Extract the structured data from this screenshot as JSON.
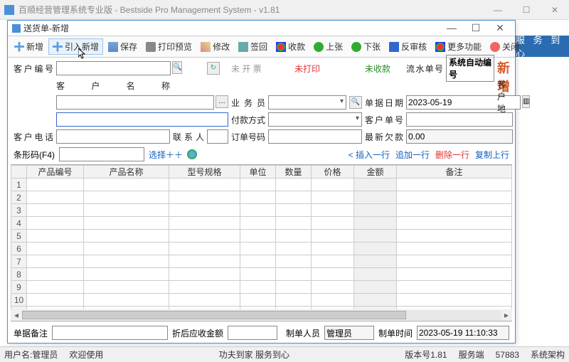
{
  "outer": {
    "title": "百顺经营管理系统专业版 - Bestside Pro Management System - v1.81",
    "min": "—",
    "max": "☐",
    "close": "✕"
  },
  "banner": "服 务 到 心",
  "inner": {
    "title": "送货单-新增",
    "min": "—",
    "max": "☐",
    "close": "✕"
  },
  "toolbar": {
    "new": "新增",
    "import": "引入新增",
    "save": "保存",
    "print": "打印预览",
    "edit": "修改",
    "sign": "签回",
    "pay": "收款",
    "prev": "上张",
    "next": "下张",
    "review": "反审核",
    "more": "更多功能",
    "close": "关闭"
  },
  "status_flags": {
    "unbilled": "未 开 票",
    "unprinted": "未打印",
    "unpaid": "未收款"
  },
  "labels": {
    "cust_no": "客户编号",
    "cust_name": "客户名称",
    "cust_addr": "客户地址",
    "cust_tel": "客户电话",
    "contact": "联系人",
    "salesman": "业务员",
    "pay_method": "付款方式",
    "order_no": "订单号码",
    "flow_no": "流水单号",
    "doc_date": "单据日期",
    "cust_doc": "客户单号",
    "latest_owe": "最新欠款",
    "barcode": "条形码(F4)",
    "select": "选择＋＋",
    "remark": "单据备注",
    "after_disc": "折后应收金额",
    "maker": "制单人员",
    "maketime": "制单时间"
  },
  "values": {
    "cust_no": "",
    "cust_name": "",
    "cust_addr": "",
    "cust_tel": "",
    "contact": "",
    "salesman": "",
    "pay_method": "",
    "order_no": "",
    "flow_no": "系统自动编号",
    "doc_date": "2023-05-19",
    "cust_doc": "",
    "latest_owe": "0.00",
    "barcode": "",
    "remark": "",
    "after_disc": "",
    "maker": "管理员",
    "maketime": "2023-05-19 11:10:33"
  },
  "big_new": "新增",
  "row_actions": {
    "insert": "< 插入一行",
    "append": "追加一行",
    "delete": "删除一行",
    "copy": "复制上行"
  },
  "grid": {
    "headers": [
      "产品编号",
      "产品名称",
      "型号规格",
      "单位",
      "数量",
      "价格",
      "金额",
      "备注"
    ],
    "rowcount": 12
  },
  "statusbar": {
    "user": "用户名:管理员",
    "welcome": "欢迎使用",
    "slogan": "功夫到家 服务到心",
    "ver": "版本号1.81",
    "server": "服务端",
    "port": "57883",
    "arch": "系统架构"
  }
}
